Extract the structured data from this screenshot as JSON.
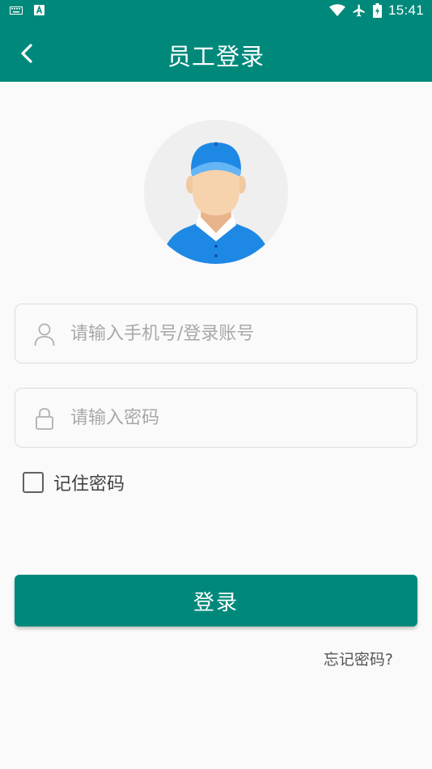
{
  "status_bar": {
    "time": "15:41",
    "icons": [
      "keyboard-icon",
      "a-notification-icon",
      "wifi-icon",
      "airplane-icon",
      "battery-icon"
    ]
  },
  "header": {
    "title": "员工登录",
    "back_icon": "chevron-left-icon"
  },
  "avatar": {
    "icon": "worker-avatar-icon"
  },
  "form": {
    "account": {
      "placeholder": "请输入手机号/登录账号",
      "value": "",
      "icon": "user-icon"
    },
    "password": {
      "placeholder": "请输入密码",
      "value": "",
      "icon": "lock-icon"
    },
    "remember": {
      "label": "记住密码",
      "checked": false
    }
  },
  "actions": {
    "login_label": "登录",
    "forgot_label": "忘记密码?"
  },
  "colors": {
    "primary": "#00897b",
    "avatar_blue": "#1e88e5",
    "background": "#fafafa"
  }
}
